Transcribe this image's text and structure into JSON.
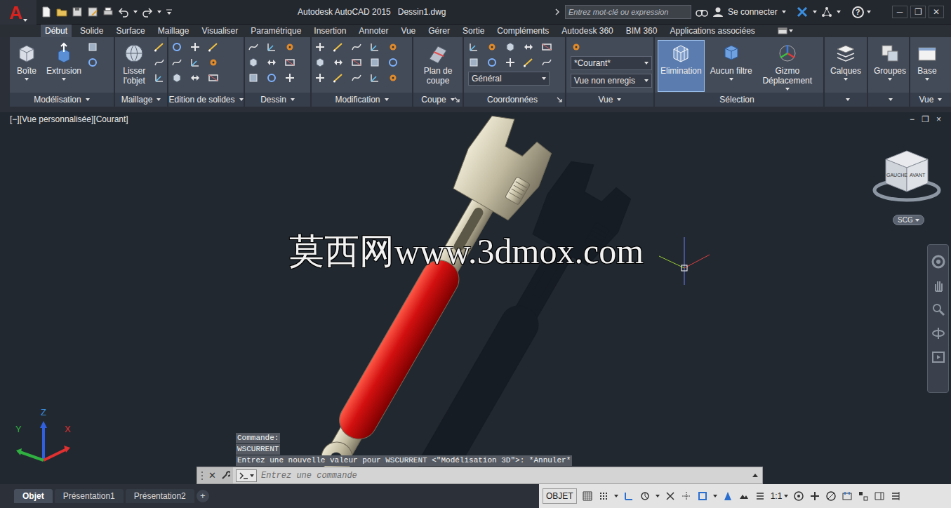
{
  "window": {
    "title": "Autodesk AutoCAD 2015",
    "file": "Dessin1.dwg",
    "controls": [
      "─",
      "❐",
      "✕"
    ]
  },
  "app_button": {
    "label": "A"
  },
  "search": {
    "placeholder": "Entrez mot-clé ou expression"
  },
  "account": {
    "label": "Se connecter"
  },
  "help": {
    "label": "?"
  },
  "ribbon_tabs": [
    {
      "label": "Début",
      "selected": true
    },
    {
      "label": "Solide",
      "selected": false
    },
    {
      "label": "Surface",
      "selected": false
    },
    {
      "label": "Maillage",
      "selected": false
    },
    {
      "label": "Visualiser",
      "selected": false
    },
    {
      "label": "Paramétrique",
      "selected": false
    },
    {
      "label": "Insertion",
      "selected": false
    },
    {
      "label": "Annoter",
      "selected": false
    },
    {
      "label": "Vue",
      "selected": false
    },
    {
      "label": "Gérer",
      "selected": false
    },
    {
      "label": "Sortie",
      "selected": false
    },
    {
      "label": "Compléments",
      "selected": false
    },
    {
      "label": "Autodesk 360",
      "selected": false
    },
    {
      "label": "BIM 360",
      "selected": false
    },
    {
      "label": "Applications associées",
      "selected": false
    }
  ],
  "ribbon_panels": [
    {
      "title": "Modélisation",
      "dropdown": true,
      "launcher": false,
      "items": [
        {
          "kind": "large",
          "label": "Boîte",
          "dropdown": true,
          "selected": false
        },
        {
          "kind": "large",
          "label": "Extrusion",
          "dropdown": true,
          "selected": false
        }
      ]
    },
    {
      "title": "Maillage",
      "dropdown": true,
      "launcher": false,
      "items": [
        {
          "kind": "large",
          "label": "Lisser l'objet",
          "dropdown": false,
          "selected": false
        }
      ]
    },
    {
      "title": "Edition de solides",
      "dropdown": true,
      "launcher": false,
      "items": []
    },
    {
      "title": "Dessin",
      "dropdown": true,
      "launcher": false,
      "items": []
    },
    {
      "title": "Modification",
      "dropdown": true,
      "launcher": false,
      "items": []
    },
    {
      "title": "Coupe",
      "dropdown": true,
      "launcher": true,
      "items": [
        {
          "kind": "large",
          "label": "Plan de coupe",
          "dropdown": false,
          "selected": false
        }
      ]
    },
    {
      "title": "Coordonnées",
      "dropdown": false,
      "launcher": true,
      "items": [
        {
          "kind": "combo",
          "value": "Général"
        }
      ]
    },
    {
      "title": "Vue",
      "dropdown": true,
      "launcher": false,
      "items": [
        {
          "kind": "combo",
          "value": "*Courant*"
        },
        {
          "kind": "combo",
          "value": "Vue non enregis"
        }
      ]
    },
    {
      "title": "Sélection",
      "dropdown": false,
      "launcher": false,
      "items": [
        {
          "kind": "large",
          "label": "Elimination",
          "dropdown": false,
          "selected": true
        },
        {
          "kind": "large",
          "label": "Aucun filtre",
          "dropdown": true,
          "selected": false
        },
        {
          "kind": "large",
          "label": "Gizmo Déplacement",
          "dropdown": true,
          "selected": false
        }
      ]
    },
    {
      "title": "",
      "dropdown": true,
      "launcher": false,
      "items": [
        {
          "kind": "large",
          "label": "Calques",
          "dropdown": true,
          "selected": false
        }
      ]
    },
    {
      "title": "",
      "dropdown": true,
      "launcher": false,
      "items": [
        {
          "kind": "large",
          "label": "Groupes",
          "dropdown": true,
          "selected": false
        }
      ]
    },
    {
      "title": "Vue",
      "dropdown": true,
      "launcher": false,
      "items": [
        {
          "kind": "large",
          "label": "Base",
          "dropdown": true,
          "selected": false
        }
      ]
    }
  ],
  "viewport": {
    "label": "[−][Vue personnalisée][Courant]",
    "controls": [
      "−",
      "❐",
      "×"
    ],
    "watermark": "莫西网www.3dmox.com",
    "viewcube": {
      "faces": [
        "GAUCHE",
        "AVANT"
      ],
      "ucs": "SCG"
    },
    "axes": [
      "X",
      "Y",
      "Z"
    ]
  },
  "command": {
    "history": [
      "Commande:",
      "WSCURRENT",
      "Entrez une nouvelle valeur pour WSCURRENT <\"Modélisation 3D\">: *Annuler*"
    ],
    "close": "✕",
    "placeholder": "Entrez une commande"
  },
  "layout_tabs": [
    {
      "label": "Objet",
      "selected": true
    },
    {
      "label": "Présentation1",
      "selected": false
    },
    {
      "label": "Présentation2",
      "selected": false
    }
  ],
  "add_layout": "+",
  "status": {
    "space": "OBJET",
    "scale": "1:1"
  }
}
